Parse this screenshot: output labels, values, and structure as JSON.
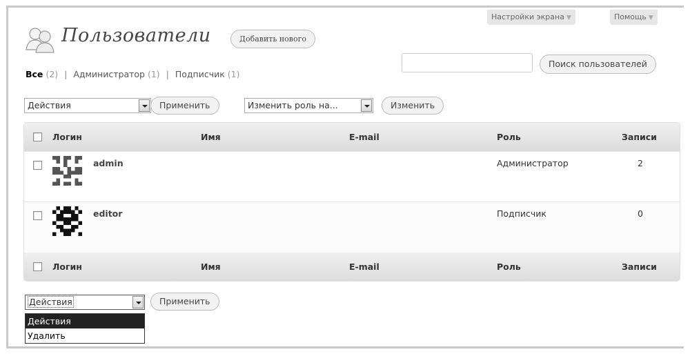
{
  "header": {
    "title": "Пользователи",
    "add_new_label": "Добавить нового",
    "screen_options_label": "Настройки экрана",
    "help_label": "Помощь"
  },
  "filters": {
    "all_label": "Все",
    "all_count": "(2)",
    "admin_label": "Администратор",
    "admin_count": "(1)",
    "subscriber_label": "Подписчик",
    "subscriber_count": "(1)",
    "separator": "|"
  },
  "search": {
    "value": "",
    "button_label": "Поиск пользователей"
  },
  "top_actions": {
    "bulk_select": "Действия",
    "apply_label": "Применить",
    "role_select": "Изменить роль на...",
    "change_label": "Изменить"
  },
  "table": {
    "columns": [
      "Логин",
      "Имя",
      "E-mail",
      "Роль",
      "Записи"
    ],
    "rows": [
      {
        "login": "admin",
        "name": "",
        "email": "",
        "role": "Администратор",
        "posts": "2"
      },
      {
        "login": "editor",
        "name": "",
        "email": "",
        "role": "Подписчик",
        "posts": "0"
      }
    ]
  },
  "bottom_actions": {
    "bulk_select": "Действия",
    "apply_label": "Применить",
    "options": [
      "Действия",
      "Удалить"
    ]
  },
  "colors": {
    "header_grad_top": "#f0f0f0",
    "header_grad_bottom": "#dcdcdc",
    "selected_option_bg": "#222222"
  }
}
